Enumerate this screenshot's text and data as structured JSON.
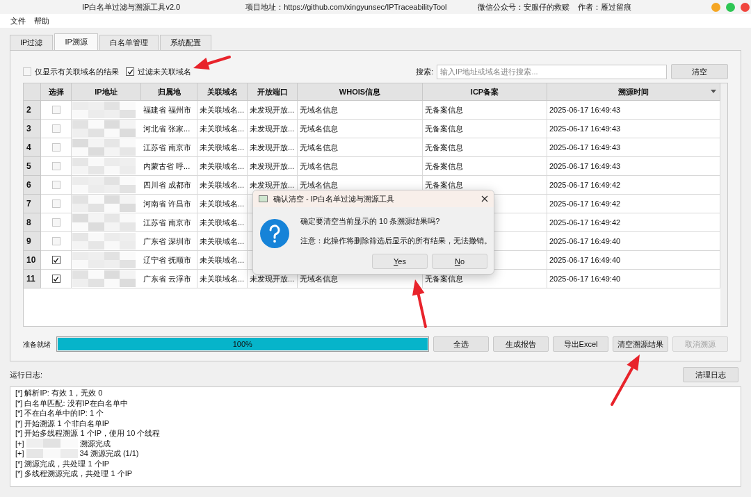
{
  "window": {
    "title": "IP白名单过滤与溯源工具v2.0",
    "project": "项目地址：https://github.com/xingyunsec/IPTraceabilityTool",
    "wechat": "微信公众号：安服仔的救赎",
    "author": "作者：雁过留痕"
  },
  "menu": [
    "文件",
    "帮助"
  ],
  "tabs": [
    {
      "label": "IP过滤",
      "selected": false
    },
    {
      "label": "IP溯源",
      "selected": true
    },
    {
      "label": "白名单管理",
      "selected": false
    },
    {
      "label": "系统配置",
      "selected": false
    }
  ],
  "filters": [
    {
      "label": "仅显示有关联域名的结果",
      "checked": false
    },
    {
      "label": "过滤未关联域名",
      "checked": true
    }
  ],
  "search": {
    "label": "搜索:",
    "placeholder": "输入IP地址或域名进行搜索...",
    "button": "清空"
  },
  "table": {
    "columns": [
      "选择",
      "IP地址",
      "归属地",
      "关联域名",
      "开放端口",
      "WHOIS信息",
      "ICP备案",
      "溯源时间"
    ],
    "rows": [
      {
        "number": "2",
        "checked": false,
        "location": "福建省 福州市",
        "domain": "未关联域名...",
        "ports": "未发现开放...",
        "whois": "无域名信息",
        "icp": "无备案信息",
        "time": "2025-06-17 16:49:43"
      },
      {
        "number": "3",
        "checked": false,
        "location": "河北省 张家...",
        "domain": "未关联域名...",
        "ports": "未发现开放...",
        "whois": "无域名信息",
        "icp": "无备案信息",
        "time": "2025-06-17 16:49:43"
      },
      {
        "number": "4",
        "checked": false,
        "location": "江苏省 南京市",
        "domain": "未关联域名...",
        "ports": "未发现开放...",
        "whois": "无域名信息",
        "icp": "无备案信息",
        "time": "2025-06-17 16:49:43"
      },
      {
        "number": "5",
        "checked": false,
        "location": "内蒙古省 呼...",
        "domain": "未关联域名...",
        "ports": "未发现开放...",
        "whois": "无域名信息",
        "icp": "无备案信息",
        "time": "2025-06-17 16:49:43"
      },
      {
        "number": "6",
        "checked": false,
        "location": "四川省 成都市",
        "domain": "未关联域名...",
        "ports": "未发现开放...",
        "whois": "无域名信息",
        "icp": "无备案信息",
        "time": "2025-06-17 16:49:42"
      },
      {
        "number": "7",
        "checked": false,
        "location": "河南省 许昌市",
        "domain": "未关联域名...",
        "time": "2025-06-17 16:49:42"
      },
      {
        "number": "8",
        "checked": false,
        "location": "江苏省 南京市",
        "domain": "未关联域名...",
        "time": "2025-06-17 16:49:42"
      },
      {
        "number": "9",
        "checked": false,
        "location": "广东省 深圳市",
        "domain": "未关联域名...",
        "time": "2025-06-17 16:49:40"
      },
      {
        "number": "10",
        "checked": true,
        "location": "辽宁省 抚顺市",
        "domain": "未关联域名...",
        "time": "2025-06-17 16:49:40"
      },
      {
        "number": "11",
        "checked": true,
        "location": "广东省 云浮市",
        "domain": "未关联域名...",
        "ports": "未发现开放...",
        "whois": "无域名信息",
        "icp": "无备案信息",
        "time": "2025-06-17 16:49:40"
      }
    ]
  },
  "status": {
    "label": "准备就绪",
    "level": 1,
    "reading": "100%"
  },
  "actions": [
    {
      "label": "全选",
      "disabled": false
    },
    {
      "label": "生成报告",
      "disabled": false
    },
    {
      "label": "导出Excel",
      "disabled": false
    },
    {
      "label": "清空溯源结果",
      "disabled": false
    },
    {
      "label": "取消溯源",
      "disabled": true
    }
  ],
  "log": {
    "label": "运行日志:",
    "button": "清理日志",
    "lines": [
      {
        "prefix": "[*]",
        "text": "解析IP: 有效 1，无效 0",
        "redacted": false
      },
      {
        "prefix": "[*]",
        "text": "白名单匹配: 没有IP在白名单中",
        "redacted": false
      },
      {
        "prefix": "[*]",
        "text": "不在白名单中的IP: 1 个",
        "redacted": false
      },
      {
        "prefix": "[*]",
        "text": "开始溯源 1 个非白名单IP",
        "redacted": false
      },
      {
        "prefix": "[*]",
        "text": "开始多线程溯源 1 个IP，使用 10 个线程",
        "redacted": false
      },
      {
        "prefix": "[+]",
        "text": "溯源完成",
        "redacted": true
      },
      {
        "prefix": "[+]",
        "text": "34 溯源完成 (1/1)",
        "redacted": true
      },
      {
        "prefix": "[*]",
        "text": "溯源完成，共处理 1 个IP",
        "redacted": false
      },
      {
        "prefix": "[*]",
        "text": "多线程溯源完成，共处理 1 个IP",
        "redacted": false
      }
    ]
  },
  "dialog": {
    "title": "确认清空 - IP白名单过滤与溯源工具",
    "message": "确定要清空当前显示的 10 条溯源结果吗?",
    "note": "注意：此操作将删除筛选后显示的所有结果，无法撤销。",
    "buttons": [
      "Yes",
      "No"
    ]
  }
}
